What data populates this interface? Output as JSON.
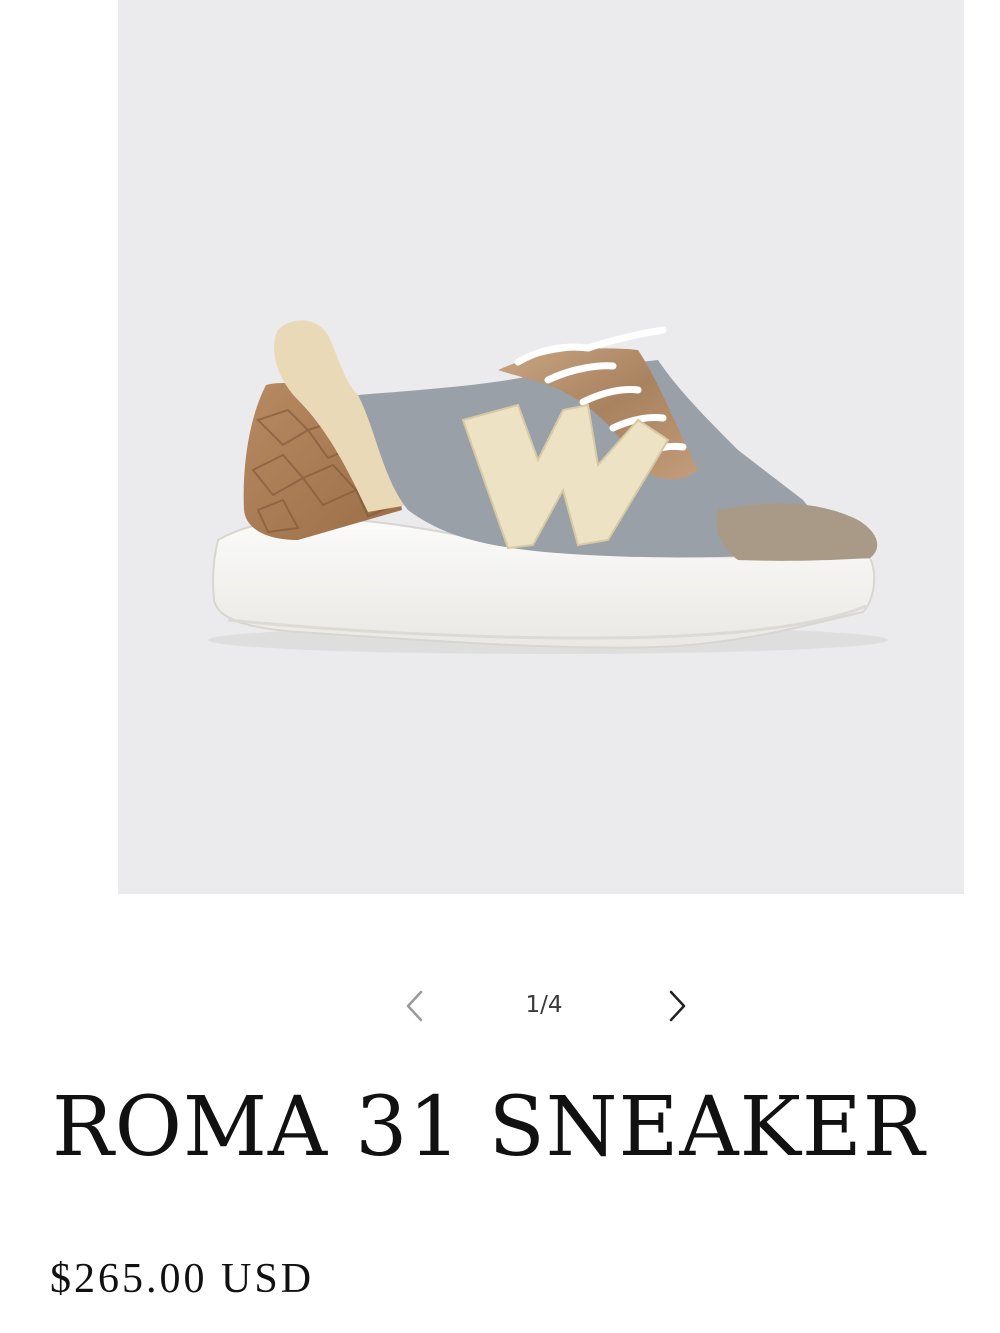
{
  "product": {
    "title": "ROMA 31 SNEAKER",
    "price": "$265.00 USD",
    "image": {
      "description_icon": "sneaker-product-photo",
      "background_color": "#ebebed"
    }
  },
  "gallery": {
    "counter": "1/4",
    "prev_icon": "chevron-left-icon",
    "next_icon": "chevron-right-icon"
  },
  "colors": {
    "text": "#111111",
    "muted": "#8a8a8a"
  }
}
